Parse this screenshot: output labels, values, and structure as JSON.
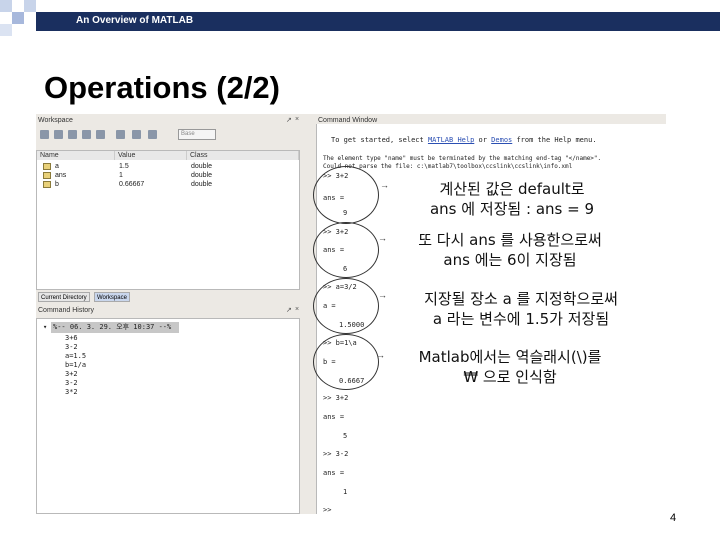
{
  "slide": {
    "header": "An Overview of MATLAB",
    "title": "Operations (2/2)",
    "page_number": "4"
  },
  "workspace": {
    "title": "Workspace",
    "stack_select": "Base",
    "columns": [
      "Name",
      "Value",
      "Class"
    ],
    "rows": [
      {
        "name": "a",
        "value": "1.5",
        "class": "double"
      },
      {
        "name": "ans",
        "value": "1",
        "class": "double"
      },
      {
        "name": "b",
        "value": "0.66667",
        "class": "double"
      }
    ]
  },
  "tabs": [
    "Current Directory",
    "Workspace"
  ],
  "history": {
    "title": "Command History",
    "entries": [
      "%-- 06. 3. 29. 오후 10:37 --%",
      "3+6",
      "3-2",
      "a=1.5",
      "b=1/a",
      "3+2",
      "3-2",
      "3*2"
    ]
  },
  "command_window": {
    "title": "Command Window",
    "intro": [
      "To get started, select",
      "MATLAB Help",
      "or",
      "Demos",
      "from the Help menu."
    ],
    "error_lines": [
      "The element type \"name\" must be terminated by the matching end-tag \"</name>\".",
      "Could not parse the file: c:\\matlab7\\toolbox\\ccslink\\ccslink\\info.xml"
    ],
    "lines": [
      ">> 3+2",
      "ans =",
      "9",
      ">> 3+2",
      "ans =",
      "6",
      ">> a=3/2",
      "a =",
      "1.5000",
      ">> b=1\\a",
      "b =",
      "0.6667",
      ">> 3+2",
      "ans =",
      "5",
      ">> 3-2",
      "ans =",
      "1",
      ">>"
    ]
  },
  "annotations": [
    [
      "계산된 값은 default로",
      "ans 에 저장됨 : ans = 9"
    ],
    [
      "또 다시 ans 를 사용한으로써",
      "ans 에는 6이 지장됨"
    ],
    [
      "지장될 장소 a 를 지정학으로써",
      "a 라는 변수에 1.5가 저장됨"
    ],
    [
      "Matlab에서는 역슬래시(\\)를",
      "₩ 으로 인식함"
    ]
  ],
  "colors": {
    "header_bar": "#1a2f5f",
    "decoration": "#c8d4ea",
    "link": "#2b4fb3"
  }
}
